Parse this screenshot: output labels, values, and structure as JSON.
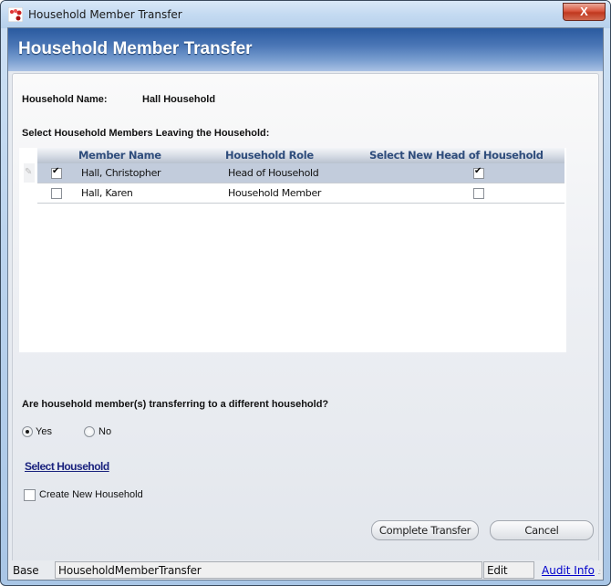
{
  "window": {
    "title": "Household Member Transfer",
    "close_label": "X"
  },
  "banner": {
    "title": "Household Member Transfer"
  },
  "household": {
    "name_label": "Household Name:",
    "name_value": "Hall Household"
  },
  "members_section": {
    "label": "Select Household Members Leaving the Household:",
    "columns": [
      "Member Name",
      "Household Role",
      "Select New Head of Household"
    ],
    "rows": [
      {
        "selected": true,
        "member_name": "Hall, Christopher",
        "role": "Head of Household",
        "new_head": true,
        "highlighted": true
      },
      {
        "selected": false,
        "member_name": "Hall, Karen",
        "role": "Household Member",
        "new_head": false,
        "highlighted": false
      }
    ]
  },
  "transfer_question": {
    "label": "Are household member(s) transferring to a different household?",
    "options": [
      "Yes",
      "No"
    ],
    "selected": "Yes"
  },
  "select_household_link": "Select Household",
  "create_new_household": {
    "label": "Create New Household",
    "checked": false
  },
  "buttons": {
    "complete": "Complete Transfer",
    "cancel": "Cancel"
  },
  "status_bar": {
    "left": "Base",
    "form_name": "HouseholdMemberTransfer",
    "mode": "Edit",
    "audit_link": "Audit Info"
  }
}
